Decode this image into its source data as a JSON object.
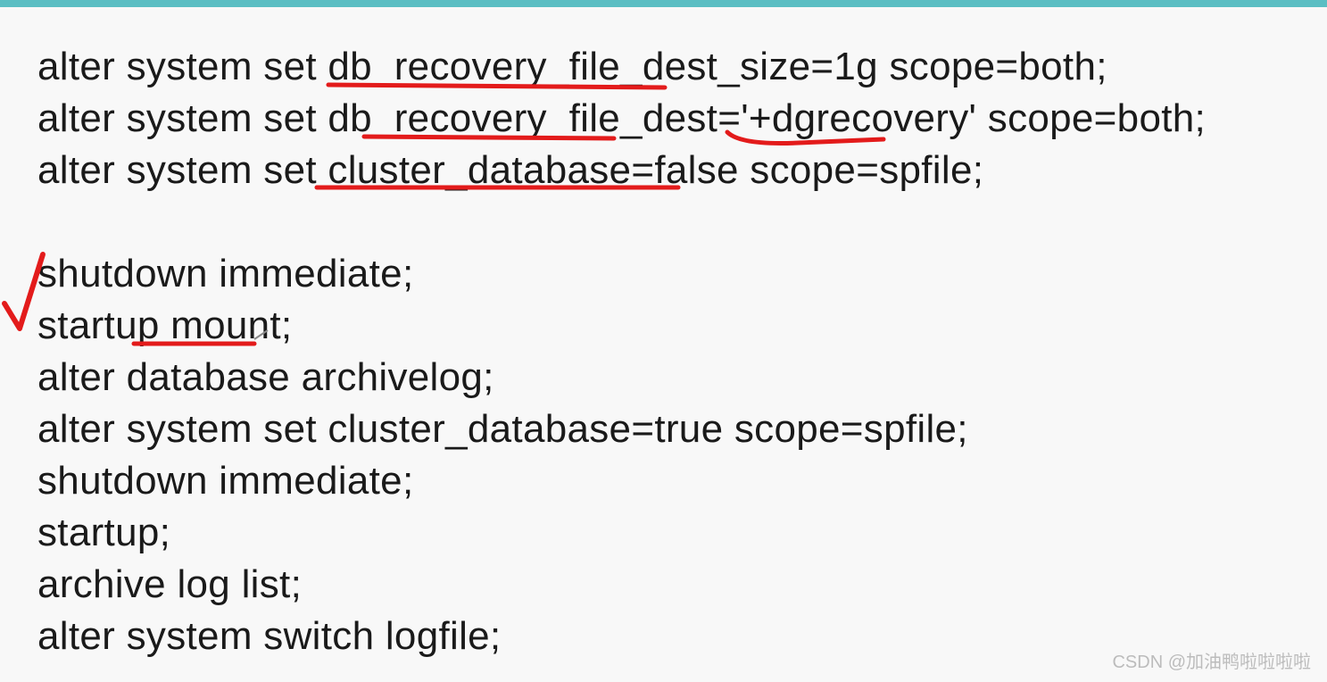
{
  "code": {
    "block1": {
      "line1": "alter system set db_recovery_file_dest_size=1g scope=both;",
      "line2": "alter system set db_recovery_file_dest='+dgrecovery' scope=both;",
      "line3": "alter system set cluster_database=false scope=spfile;"
    },
    "block2": {
      "line1": "shutdown immediate;",
      "line2": "startup mount;",
      "line3": "alter database archivelog;",
      "line4": "alter system set cluster_database=true scope=spfile;",
      "line5": "shutdown immediate;",
      "line6": "startup;",
      "line7": "archive log list;",
      "line8": "alter system switch logfile;"
    }
  },
  "watermark": "CSDN @加油鸭啦啦啦啦",
  "annotations": {
    "color": "#e31b1b"
  }
}
